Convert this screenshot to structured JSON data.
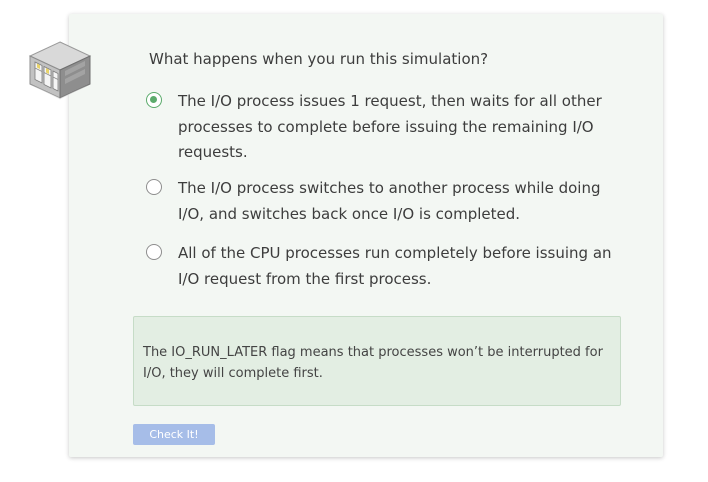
{
  "quiz": {
    "question": "What happens when you run this simulation?",
    "options": [
      {
        "label": "The I/O process issues 1 request, then waits for all other processes to complete before issuing the remaining I/O requests.",
        "selected": true
      },
      {
        "label": "The I/O process switches to another process while doing I/O, and switches back once I/O is completed.",
        "selected": false
      },
      {
        "label": "All of the CPU processes run completely before issuing an I/O request from the first process.",
        "selected": false
      }
    ],
    "feedback": "The IO_RUN_LATER flag means that processes won’t be interrupted for I/O, they will complete first.",
    "check_label": "Check It!"
  },
  "icons": {
    "logo": "isometric-building-icon"
  },
  "colors": {
    "accent_green": "#5cab6c",
    "button_blue": "#a6bde8",
    "card_bg": "#f3f7f3",
    "feedback_bg": "#e3eee3"
  }
}
